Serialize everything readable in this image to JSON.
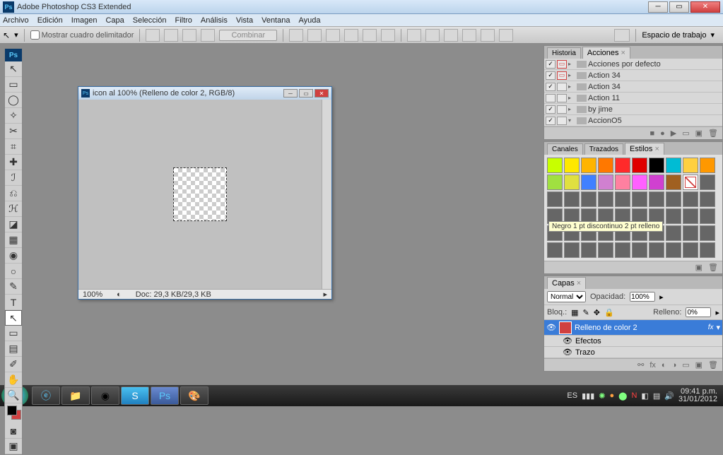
{
  "titlebar": {
    "app_icon": "Ps",
    "title": "Adobe Photoshop CS3 Extended"
  },
  "menu": {
    "items": [
      "Archivo",
      "Edición",
      "Imagen",
      "Capa",
      "Selección",
      "Filtro",
      "Análisis",
      "Vista",
      "Ventana",
      "Ayuda"
    ]
  },
  "optbar": {
    "show_bbox": "Mostrar cuadro delimitador",
    "combine": "Combinar",
    "workspace_label": "Espacio de trabajo"
  },
  "document": {
    "title": "icon al 100% (Relleno de color 2, RGB/8)",
    "zoom": "100%",
    "docsize": "Doc: 29,3 KB/29,3 KB"
  },
  "actions_panel": {
    "tabs": [
      "Historia",
      "Acciones"
    ],
    "rows": [
      {
        "check": true,
        "red": true,
        "label": "Acciones por defecto"
      },
      {
        "check": true,
        "red": true,
        "label": "Action 34"
      },
      {
        "check": true,
        "red": false,
        "label": "Action 34"
      },
      {
        "check": false,
        "red": false,
        "label": "Action 11"
      },
      {
        "check": true,
        "red": false,
        "label": "by jime"
      },
      {
        "check": true,
        "red": false,
        "label": "AccionO5",
        "open": true
      }
    ]
  },
  "styles_panel": {
    "tabs": [
      "Canales",
      "Trazados",
      "Estilos"
    ],
    "colors": [
      "#c8ff00",
      "#ffe800",
      "#ffb400",
      "#ff7800",
      "#ff2a2a",
      "#e00000",
      "#000000",
      "#00bcd4",
      "#ffd040",
      "#ff9800",
      "#a0e040",
      "#e0e040",
      "#4080ff",
      "#d080d0",
      "#ff80a0",
      "#ff60ff",
      "#d040d0",
      "#a06020",
      "none"
    ],
    "tooltip": "Negro 1 pt discontinuo 2 pt relleno"
  },
  "layers_panel": {
    "tab": "Capas",
    "blend": "Normal",
    "opacity_label": "Opacidad:",
    "opacity": "100%",
    "lock_label": "Bloq.:",
    "fill_label": "Relleno:",
    "fill": "0%",
    "layer_name": "Relleno de color 2",
    "fx": "fx",
    "effects": "Efectos",
    "stroke": "Trazo"
  },
  "taskbar": {
    "lang": "ES",
    "time": "09:41 p.m.",
    "date": "31/01/2012"
  }
}
